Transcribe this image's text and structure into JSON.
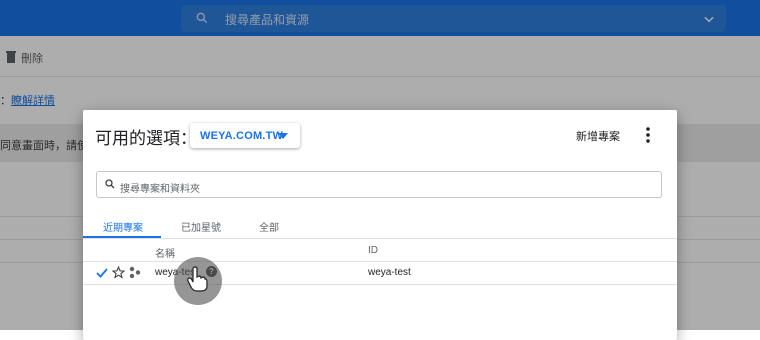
{
  "topbar": {
    "search_placeholder": "搜尋產品和資源",
    "search_icon": "search-icon",
    "chevron_icon": "chevron-down-icon"
  },
  "background": {
    "delete_label": "刪除",
    "info_prefix": "：",
    "info_link": "瞭解詳情",
    "banner_text": "同意畫面時，請使用"
  },
  "dialog": {
    "title": "可用的選項：",
    "org_value": "WEYA.COM.TW",
    "new_project": "新增專案",
    "more_icon": "more-vert-icon",
    "search_placeholder": "搜尋專案和資料夾",
    "tabs": [
      {
        "label": "近期專案",
        "active": true
      },
      {
        "label": "已加星號",
        "active": false
      },
      {
        "label": "全部",
        "active": false
      }
    ],
    "columns": {
      "name": "名稱",
      "id": "ID"
    },
    "rows": [
      {
        "name": "weya-test",
        "id": "weya-test",
        "selected": true,
        "starred": false
      }
    ]
  },
  "colors": {
    "brand": "#1a73e8"
  }
}
